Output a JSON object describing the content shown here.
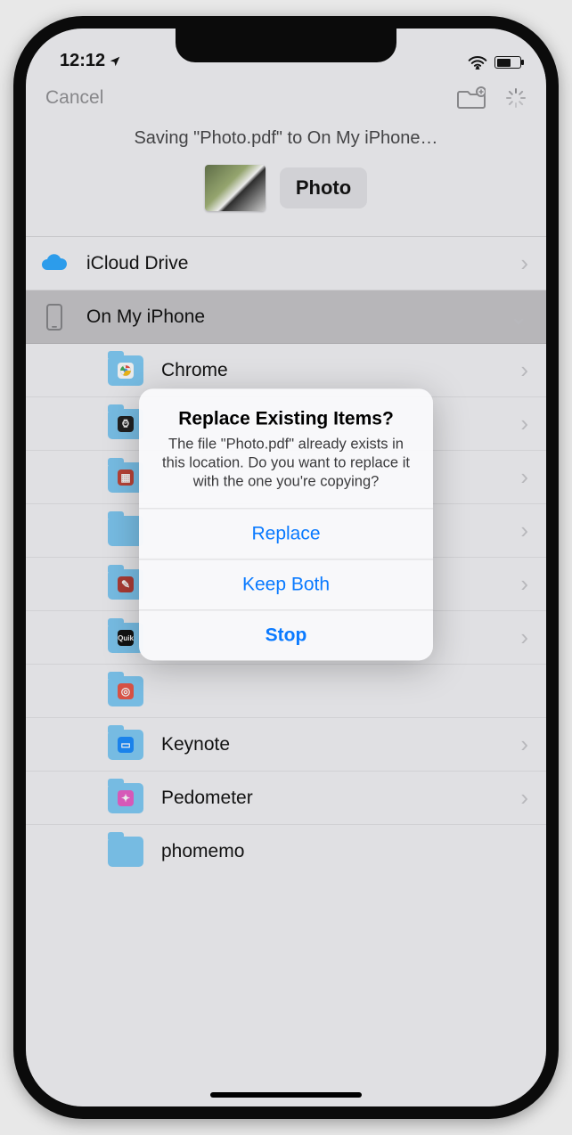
{
  "status": {
    "time": "12:12"
  },
  "nav": {
    "cancel": "Cancel"
  },
  "header": {
    "saving_text": "Saving \"Photo.pdf\" to On My iPhone…",
    "filename": "Photo"
  },
  "locations": {
    "icloud": "iCloud Drive",
    "on_my_iphone": "On My iPhone"
  },
  "folders": [
    {
      "label": "Chrome"
    },
    {
      "label": ""
    },
    {
      "label": ""
    },
    {
      "label": ""
    },
    {
      "label": ""
    },
    {
      "label": ""
    },
    {
      "label": ""
    },
    {
      "label": "Keynote"
    },
    {
      "label": "Pedometer"
    },
    {
      "label": "phomemo"
    }
  ],
  "alert": {
    "title": "Replace Existing Items?",
    "message": "The file \"Photo.pdf\" already exists in this location. Do you want to replace it with the one you're copying?",
    "replace": "Replace",
    "keep_both": "Keep Both",
    "stop": "Stop"
  }
}
